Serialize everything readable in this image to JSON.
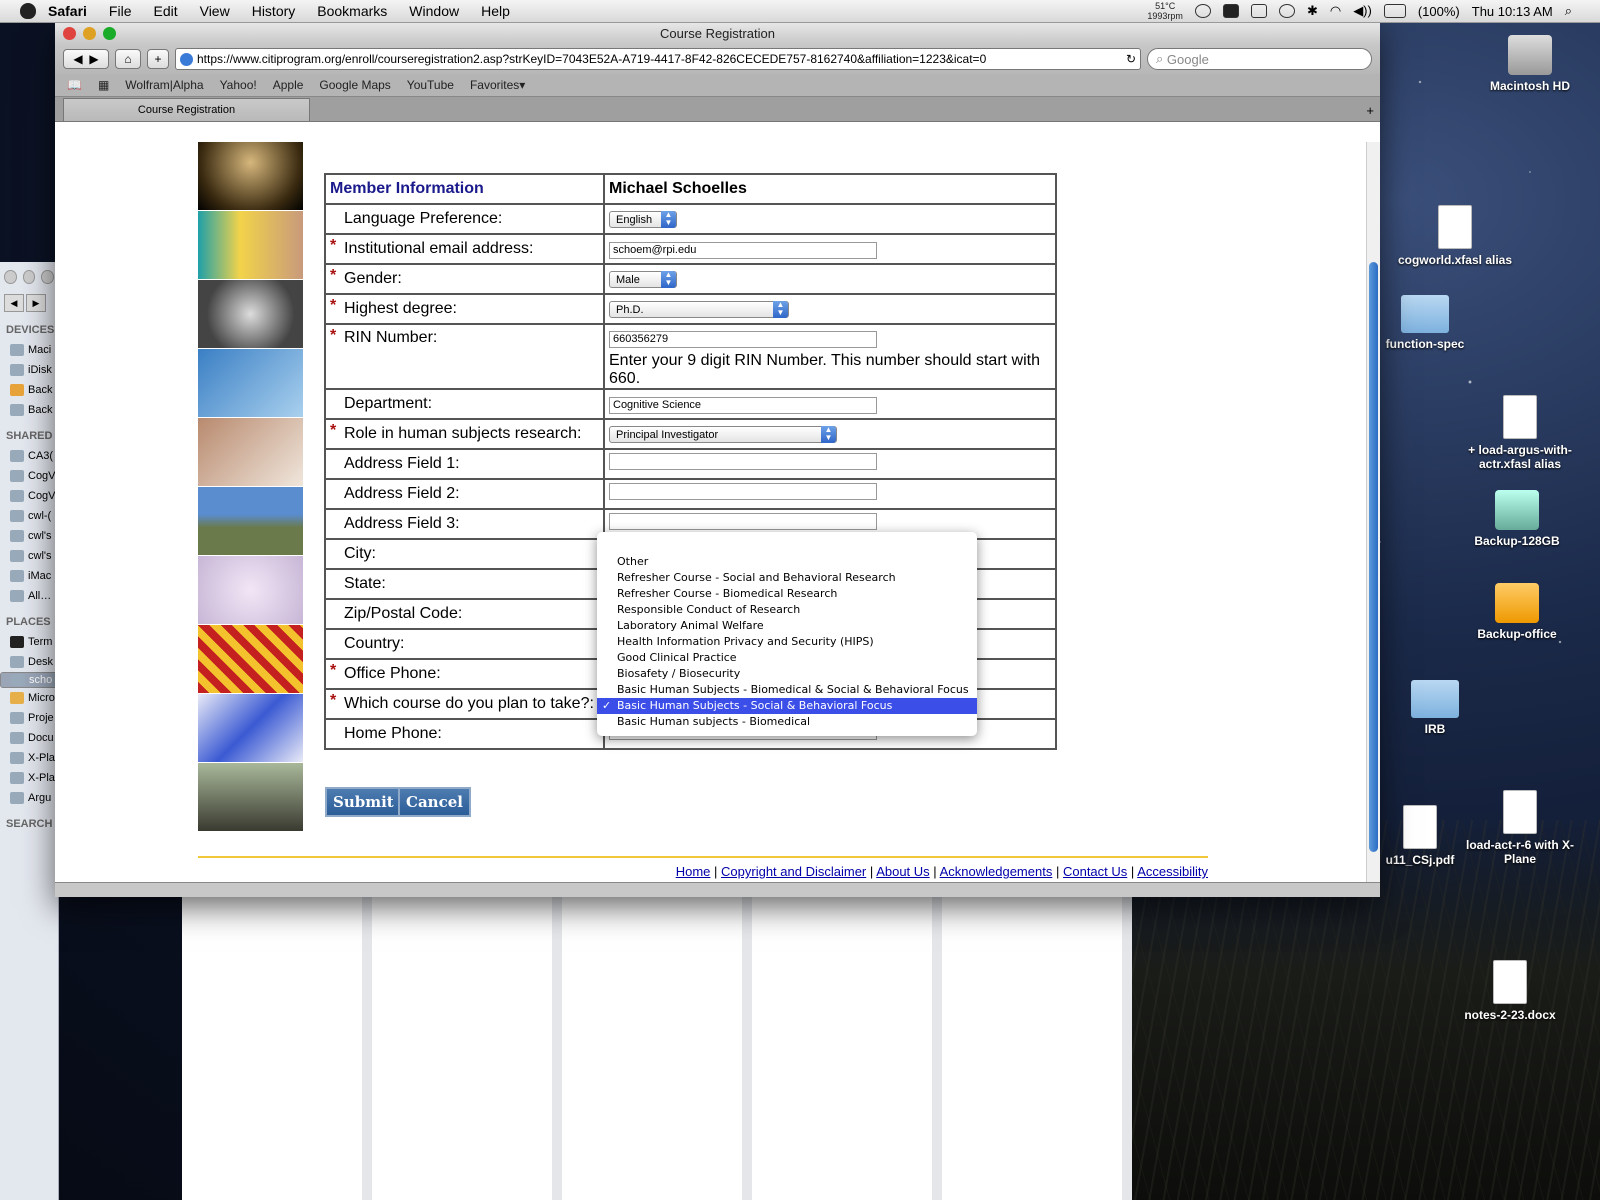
{
  "menubar": {
    "app": "Safari",
    "items": [
      "File",
      "Edit",
      "View",
      "History",
      "Bookmarks",
      "Window",
      "Help"
    ],
    "temp": "51°C",
    "rpm": "1993rpm",
    "battery": "(100%)",
    "clock": "Thu 10:13 AM"
  },
  "finder": {
    "devices_heading": "DEVICES",
    "devices": [
      "Maci",
      "iDisk",
      "Back",
      "Back"
    ],
    "shared_heading": "SHARED",
    "shared": [
      "CA3(",
      "CogV",
      "CogV",
      "cwl-(",
      "cwl's",
      "cwl's",
      "iMac",
      "All…"
    ],
    "places_heading": "PLACES",
    "places": [
      "Term",
      "Desk",
      "scho",
      "Micro",
      "Proje",
      "Docu",
      "X-Pla",
      "X-Pla",
      "Argu"
    ],
    "search_heading": "SEARCH"
  },
  "browser": {
    "window_title": "Course Registration",
    "url": "https://www.citiprogram.org/enroll/courseregistration2.asp?strKeyID=7043E52A-A719-4417-8F42-826CECEDE757-8162740&affiliation=1223&icat=0",
    "search_placeholder": "Google",
    "bookmarks": [
      "Wolfram|Alpha",
      "Yahoo!",
      "Apple",
      "Google Maps",
      "YouTube",
      "Favorites▾"
    ],
    "tab_label": "Course Registration"
  },
  "form": {
    "header_left": "Member Information",
    "header_right": "Michael Schoelles",
    "language_label": "Language Preference:",
    "language_value": "English",
    "email_label": "Institutional email address:",
    "email_value": "schoem@rpi.edu",
    "gender_label": "Gender:",
    "gender_value": "Male",
    "degree_label": "Highest degree:",
    "degree_value": "Ph.D.",
    "rin_label": "RIN Number:",
    "rin_value": "660356279",
    "rin_hint": "Enter your 9 digit RIN Number. This number should start with 660.",
    "department_label": "Department:",
    "department_value": "Cognitive Science",
    "role_label": "Role in human subjects research:",
    "role_value": "Principal Investigator",
    "address1_label": "Address Field 1:",
    "address2_label": "Address Field 2:",
    "address3_label": "Address Field 3:",
    "city_label": "City:",
    "state_label": "State:",
    "zip_label": "Zip/Postal Code:",
    "country_label": "Country:",
    "office_phone_label": "Office Phone:",
    "course_label": "Which course do you plan to take?:",
    "home_phone_label": "Home Phone:",
    "required_marker": "*",
    "submit_label": "Submit",
    "cancel_label": "Cancel"
  },
  "course_dropdown": {
    "options": [
      "Other",
      "Refresher Course - Social and Behavioral Research",
      "Refresher Course - Biomedical Research",
      "Responsible Conduct of Research",
      "Laboratory Animal Welfare",
      "Health Information Privacy and Security (HIPS)",
      "Good Clinical Practice",
      "Biosafety / Biosecurity",
      "Basic Human Subjects - Biomedical & Social & Behavioral Focus",
      "Basic Human Subjects - Social & Behavioral Focus",
      "Basic Human subjects - Biomedical"
    ],
    "selected_index": 9,
    "checkmark": "✓"
  },
  "footer": {
    "links": [
      "Home",
      "Copyright and Disclaimer",
      "About Us",
      "Acknowledgements",
      "Contact Us",
      "Accessibility"
    ],
    "separator": "|"
  },
  "desktop": {
    "icons": [
      "Macintosh HD",
      "cogworld.xfasl alias",
      "function-spec",
      "+ load-argus-with-actr.xfasl alias",
      "Backup-128GB",
      "Backup-office",
      "IRB",
      "u11_CSj.pdf",
      "load-act-r-6 with X-Plane",
      "notes-2-23.docx"
    ]
  },
  "colors": {
    "accent": "#3c4ee8",
    "button": "#2b5d98",
    "required": "#aa1111",
    "header_text": "#1a1a8c"
  }
}
